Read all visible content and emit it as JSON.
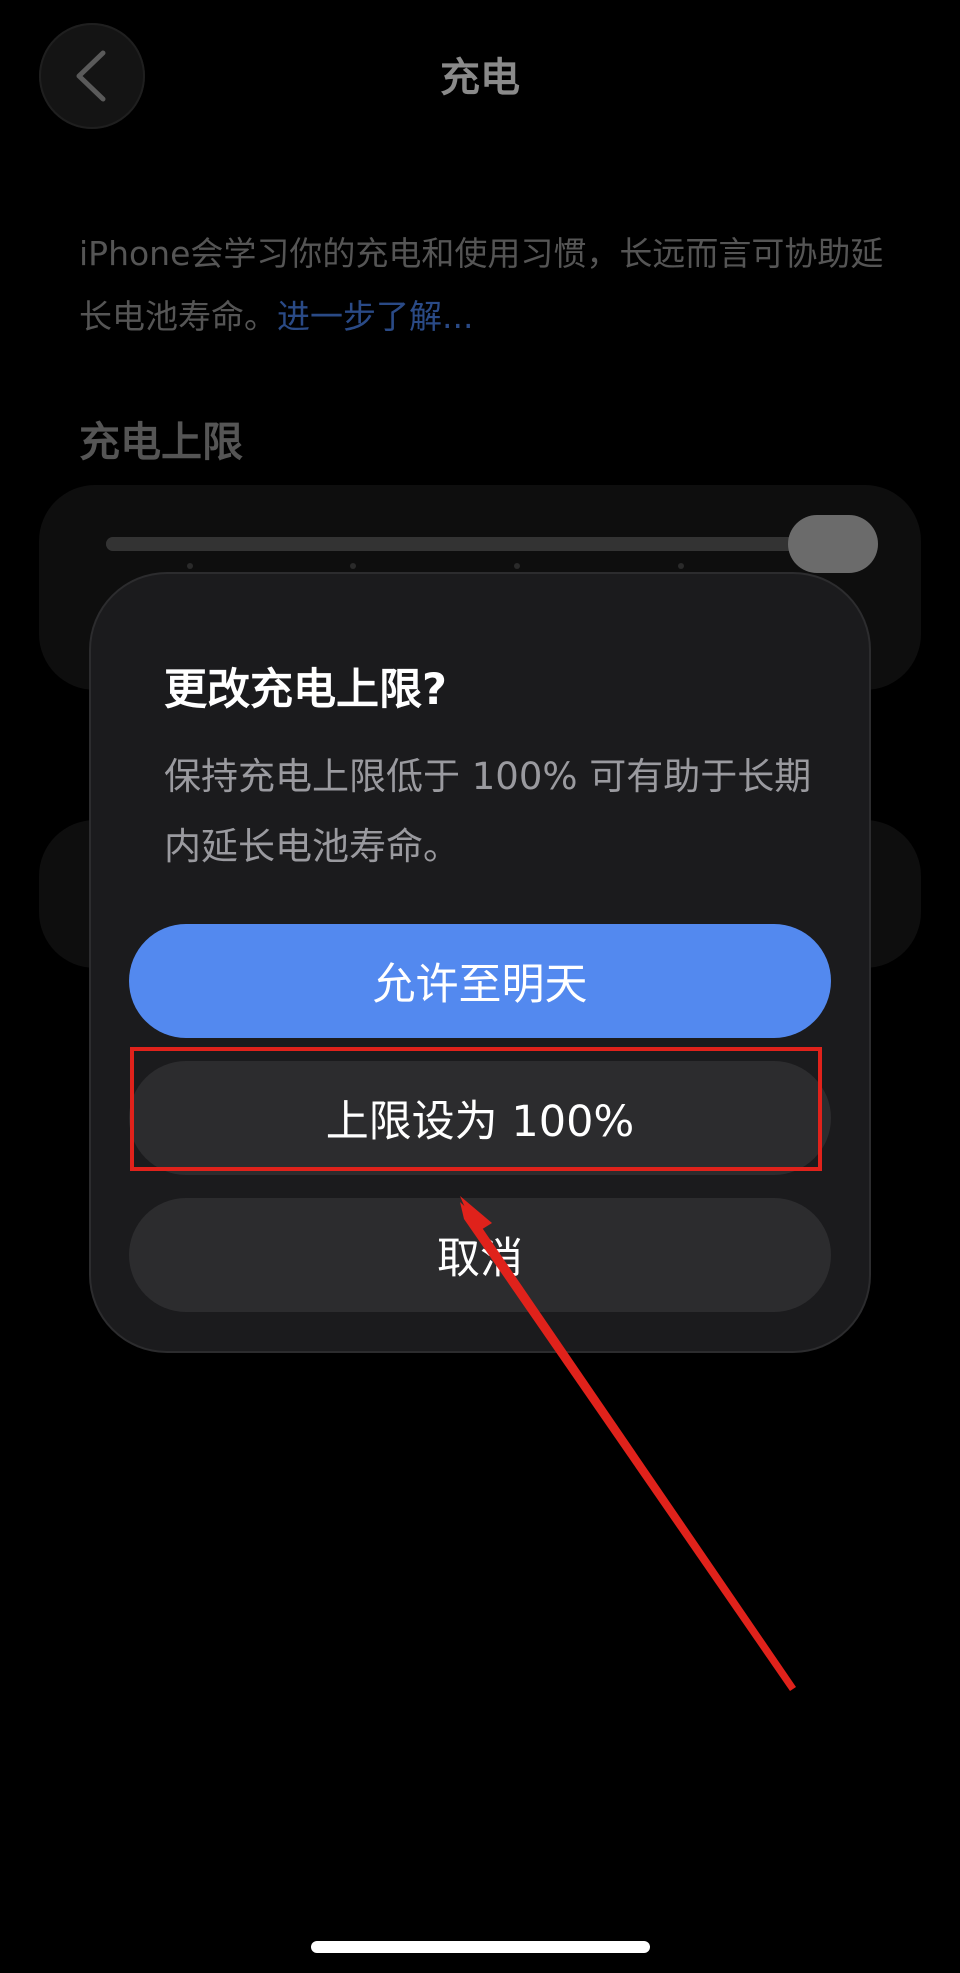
{
  "nav": {
    "title": "充电",
    "back_icon": "chevron-left-icon"
  },
  "intro": {
    "text": "iPhone会学习你的充电和使用习惯，长远而言可协助延长电池寿命。",
    "link": "进一步了解..."
  },
  "charge_limit": {
    "header": "充电上限",
    "slider_value_percent": 100
  },
  "alert": {
    "title": "更改充电上限?",
    "message": "保持充电上限低于 100% 可有助于长期内延长电池寿命。",
    "buttons": {
      "allow_until_tomorrow": "允许至明天",
      "set_limit_100": "上限设为 100%",
      "cancel": "取消"
    }
  },
  "colors": {
    "background": "#000000",
    "alert_bg": "#1b1b1d",
    "primary_button": "#5389ef",
    "secondary_button": "#2c2c2e",
    "annotation_red": "#e0221b",
    "link_dimmed": "#2a4a86"
  }
}
